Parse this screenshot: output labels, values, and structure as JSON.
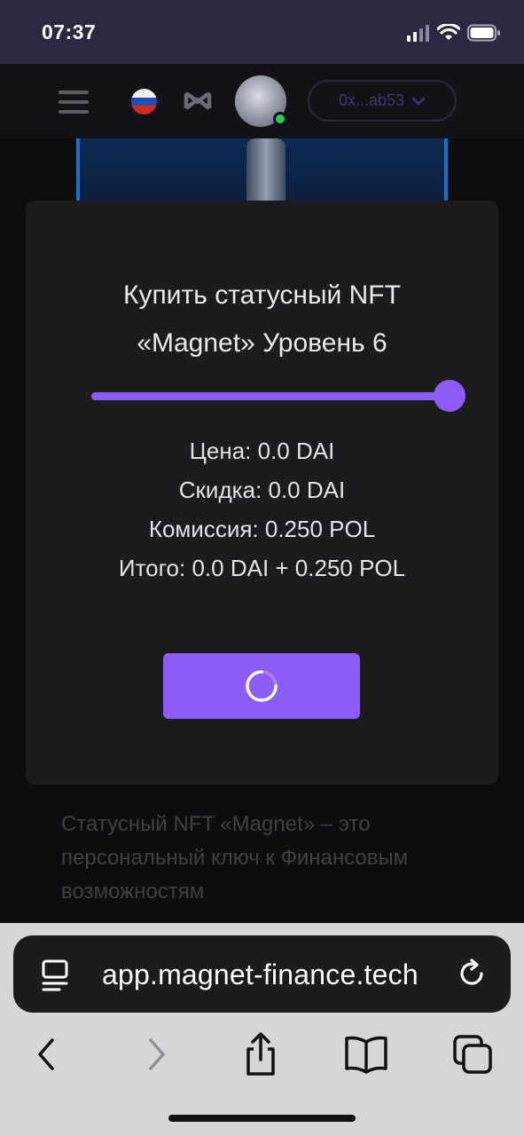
{
  "status_bar": {
    "time": "07:37"
  },
  "header": {
    "wallet_address": "0x...ab53"
  },
  "modal": {
    "title": "Купить статусный NFT «Magnet» Уровень 6",
    "level_slider": {
      "value": 6,
      "max": 6,
      "fill_fraction": 1.0
    },
    "summary": {
      "price": "Цена: 0.0 DAI",
      "discount": "Скидка: 0.0 DAI",
      "fee": "Комиссия: 0.250 POL",
      "total": "Итого: 0.0 DAI + 0.250 POL"
    },
    "buy_button_state": "loading"
  },
  "background": {
    "description_text": "Статусный NFT «Magnet» – это персональный ключ к Финансовым возможностям"
  },
  "browser": {
    "url": "app.magnet-finance.tech"
  },
  "colors": {
    "accent": "#8b5cf6",
    "status_bar": "#2e2743",
    "modal_bg": "#1c1c1f",
    "online_dot": "#2ecc5a"
  },
  "icons": [
    "hamburger-menu-icon",
    "russian-flag-icon",
    "magnet-logo-icon",
    "avatar-nft-icon",
    "chevron-down-icon",
    "loading-spinner-icon",
    "page-menu-icon",
    "reload-icon",
    "back-icon",
    "forward-icon",
    "share-icon",
    "bookmarks-icon",
    "tabs-icon"
  ]
}
